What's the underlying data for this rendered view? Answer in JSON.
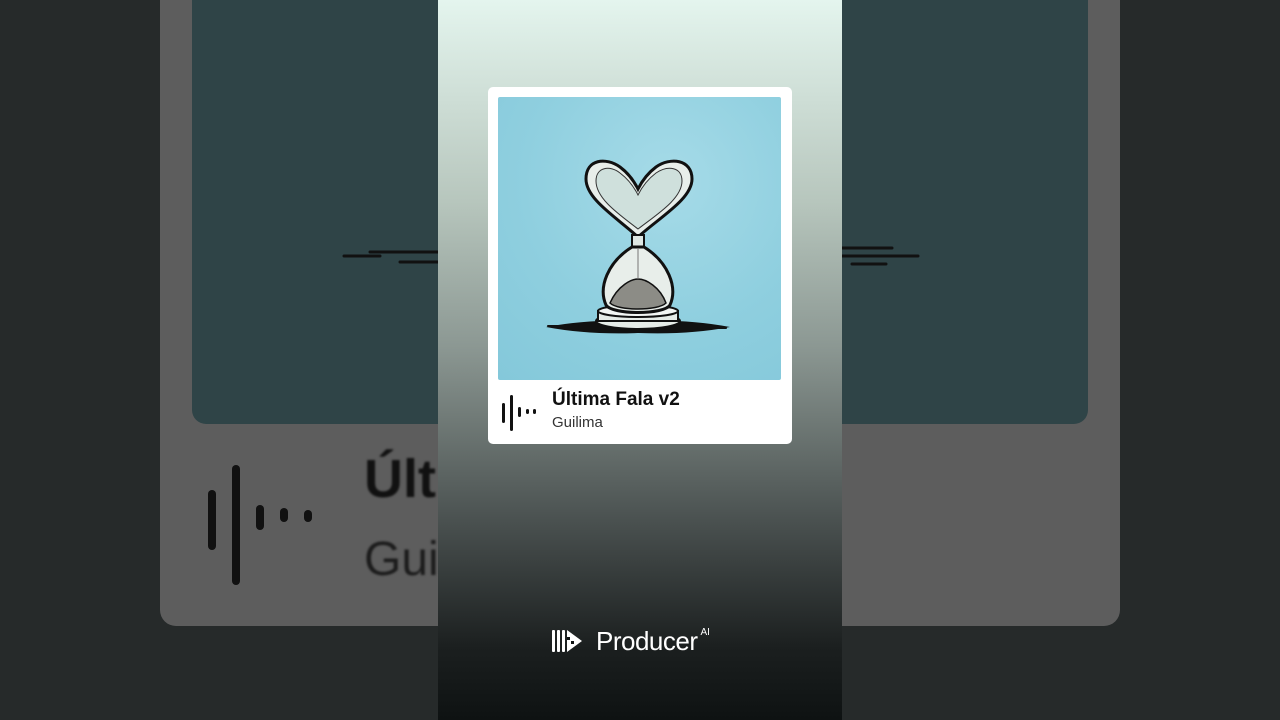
{
  "song": {
    "title": "Última Fala v2",
    "artist": "Guilima"
  },
  "background": {
    "title_fragment": "Últ",
    "artist_fragment": "Gui"
  },
  "brand": {
    "name": "Producer",
    "suffix": "AI",
    "logo_icon": "producer-logo-icon"
  },
  "icons": {
    "waveform": "waveform-icon",
    "artwork": "heart-hourglass-artwork"
  },
  "colors": {
    "art_background": "#8fcfdf",
    "card": "#ffffff",
    "brand_text": "#ffffff"
  }
}
